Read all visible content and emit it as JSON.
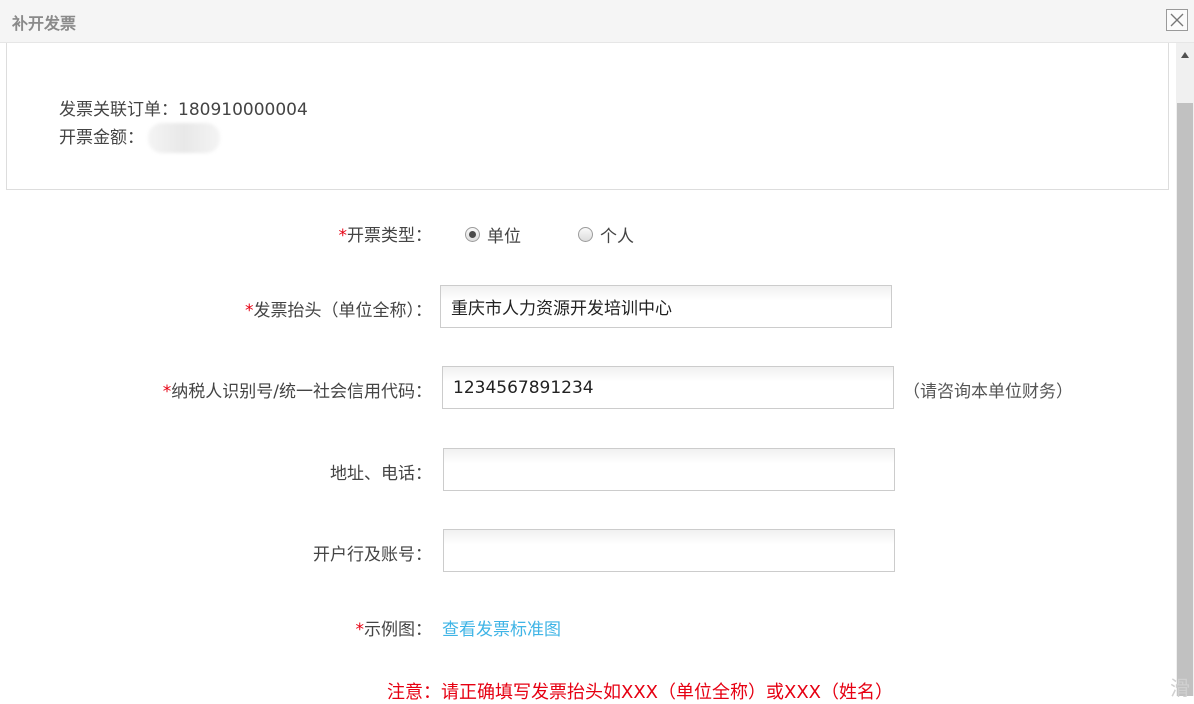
{
  "dialog": {
    "title": "补开发票",
    "close_icon": "close-icon"
  },
  "info": {
    "order_label": "发票关联订单：",
    "order_value": "180910000004",
    "amount_label": "开票金额："
  },
  "form": {
    "invoice_type": {
      "required": "*",
      "label": "开票类型：",
      "options": [
        {
          "label": "单位",
          "checked": true
        },
        {
          "label": "个人",
          "checked": false
        }
      ]
    },
    "invoice_title": {
      "required": "*",
      "label": "发票抬头（单位全称）：",
      "value": "重庆市人力资源开发培训中心"
    },
    "tax_id": {
      "required": "*",
      "label": "纳税人识别号/统一社会信用代码：",
      "value": "1234567891234",
      "hint": "（请咨询本单位财务）"
    },
    "address_phone": {
      "label": "地址、电话：",
      "value": ""
    },
    "bank_account": {
      "label": "开户行及账号：",
      "value": ""
    },
    "sample": {
      "required": "*",
      "label": "示例图：",
      "link": "查看发票标准图"
    }
  },
  "notice": "注意：请正确填写发票抬头如XXX（单位全称）或XXX（姓名）",
  "watermark": "滑",
  "colors": {
    "required": "#e60012",
    "link": "#3fb4e6"
  }
}
